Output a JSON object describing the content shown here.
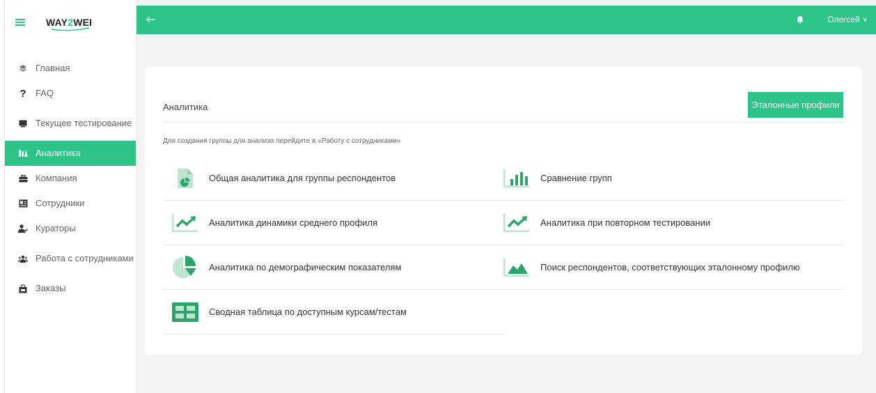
{
  "app": {
    "logo_prefix": "WAY",
    "logo_two": "2",
    "logo_suffix": "WEI",
    "brand_color": "#2ec487"
  },
  "topbar": {
    "back_icon": "arrow-left-icon",
    "bell_icon": "bell-icon",
    "user_name": "Олегсей",
    "user_chevron": "∨"
  },
  "sidebar": {
    "items": [
      {
        "label": "Главная",
        "icon": "home-icon"
      },
      {
        "label": "FAQ",
        "icon": "question-icon"
      },
      {
        "label": "Текущее тестирование",
        "icon": "monitor-icon"
      },
      {
        "label": "Аналитика",
        "icon": "analytics-icon",
        "active": true
      },
      {
        "label": "Компания",
        "icon": "briefcase-icon"
      },
      {
        "label": "Сотрудники",
        "icon": "id-card-icon"
      },
      {
        "label": "Кураторы",
        "icon": "curator-icon"
      },
      {
        "label": "Работа с сотрудниками",
        "icon": "group-icon"
      },
      {
        "label": "Заказы",
        "icon": "shopping-bag-icon"
      }
    ]
  },
  "main": {
    "title": "Аналитика",
    "etalon_button": "Эталонные профили",
    "hint": "Для создания группы для анализа перейдите в «Работу с сотрудниками»",
    "tiles": [
      {
        "label": "Общая аналитика для группы респондентов",
        "icon": "pie-document-icon"
      },
      {
        "label": "Сравнение групп",
        "icon": "bar-chart-icon"
      },
      {
        "label": "Аналитика динамики среднего профиля",
        "icon": "trend-up-icon"
      },
      {
        "label": "Аналитика при повторном тестировании",
        "icon": "trend-up-icon"
      },
      {
        "label": "Аналитика по демографическим показателям",
        "icon": "pie-chart-icon"
      },
      {
        "label": "Поиск респондентов, соответствующих эталонному профилю",
        "icon": "area-chart-icon"
      },
      {
        "label": "Сводная таблица по доступным курсам/тестам",
        "icon": "table-icon"
      }
    ]
  }
}
